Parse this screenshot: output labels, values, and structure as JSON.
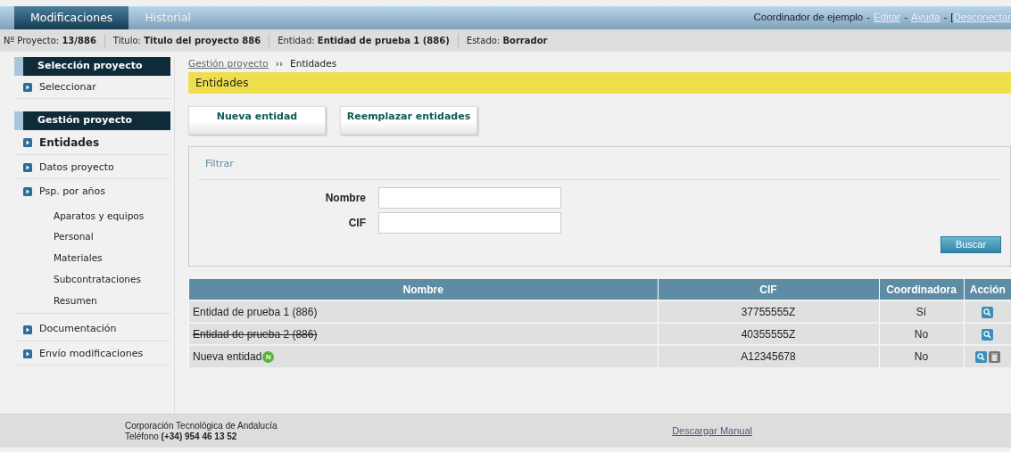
{
  "top_tabs": [
    {
      "label": "Modificaciones",
      "selected": true
    },
    {
      "label": "Historial",
      "selected": false
    }
  ],
  "user": {
    "name": "Coordinador de ejemplo",
    "separator": "-",
    "links": [
      "Editar",
      "Ayuda"
    ],
    "bracket": "[",
    "cut_link": "Desconectar"
  },
  "info_bar": [
    {
      "label": "Nº Proyecto:",
      "value": "13/886"
    },
    {
      "label": "Titulo:",
      "value": "Titulo del proyecto 886"
    },
    {
      "label": "Entidad:",
      "value": "Entidad de prueba 1 (886)"
    },
    {
      "label": "Estado:",
      "value": "Borrador"
    }
  ],
  "sidebar": [
    {
      "title": "Selección proyecto",
      "items": [
        {
          "label": "Seleccionar",
          "selected": false
        }
      ]
    },
    {
      "title": "Gestión proyecto",
      "items": [
        {
          "label": "Entidades",
          "selected": true
        },
        {
          "label": "Datos proyecto",
          "selected": false
        },
        {
          "label": "Psp. por años",
          "selected": false,
          "children": [
            {
              "label": "Aparatos y equipos"
            },
            {
              "label": "Personal"
            },
            {
              "label": "Materiales"
            },
            {
              "label": "Subcontrataciones"
            },
            {
              "label": "Resumen"
            }
          ]
        },
        {
          "label": "Documentación",
          "selected": false
        },
        {
          "label": "Envío modificaciones",
          "selected": false
        }
      ]
    }
  ],
  "breadcrumb": {
    "link": "Gestión proyecto",
    "separator": "››",
    "current": "Entidades"
  },
  "page_title": "Entidades",
  "actions": [
    "Nueva entidad",
    "Reemplazar entidades"
  ],
  "filter": {
    "title": "Filtrar",
    "fields": [
      {
        "label": "Nombre"
      },
      {
        "label": "CIF"
      }
    ],
    "button": "Buscar"
  },
  "table": {
    "columns": [
      "Nombre",
      "CIF",
      "Coordinadora",
      "Acción"
    ],
    "rows": [
      {
        "nombre": "Entidad de prueba 1 (886)",
        "deleted": false,
        "cif": "37755555Z",
        "coordinadora": "Sí",
        "actions": [
          {
            "kind": "view"
          }
        ]
      },
      {
        "nombre": "Entidad de prueba 2 (886)",
        "deleted": true,
        "cif": "40355555Z",
        "coordinadora": "No",
        "actions": [
          {
            "kind": "view"
          }
        ]
      },
      {
        "nombre": "Nueva entidad",
        "deleted": false,
        "badge": "N",
        "cif": "A12345678",
        "coordinadora": "No",
        "actions": [
          {
            "kind": "view"
          },
          {
            "kind": "delete"
          }
        ]
      }
    ]
  },
  "footer": {
    "lines": [
      "Corporación Tecnológica de Andalucía",
      "Teléfono **(+34) 954 46 13 52**"
    ],
    "link": "Descargar Manual"
  }
}
